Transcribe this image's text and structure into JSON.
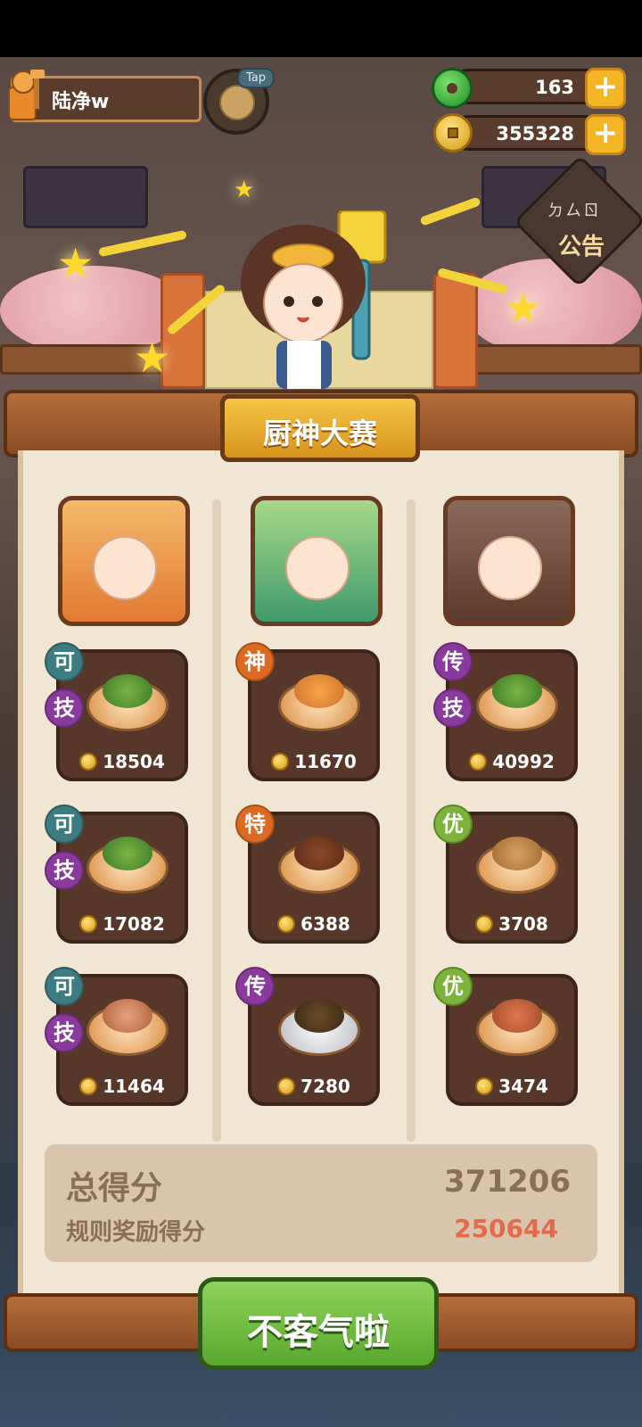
{
  "player": {
    "name": "陆净w"
  },
  "tap_button": {
    "label": "Tap"
  },
  "resources": {
    "jade": "163",
    "coins": "355328"
  },
  "notice": {
    "label": "公告",
    "sub": "ㄉㄙㄖ"
  },
  "contest": {
    "title": "厨神大赛"
  },
  "dishes": [
    {
      "score": "18504",
      "badges": [
        "可",
        "技"
      ]
    },
    {
      "score": "11670",
      "badges": [
        "神"
      ]
    },
    {
      "score": "40992",
      "badges": [
        "传",
        "技"
      ]
    },
    {
      "score": "17082",
      "badges": [
        "可",
        "技"
      ]
    },
    {
      "score": "6388",
      "badges": [
        "特"
      ]
    },
    {
      "score": "3708",
      "badges": [
        "优"
      ]
    },
    {
      "score": "11464",
      "badges": [
        "可",
        "技"
      ]
    },
    {
      "score": "7280",
      "badges": [
        "传"
      ]
    },
    {
      "score": "3474",
      "badges": [
        "优"
      ]
    }
  ],
  "summary": {
    "total_label": "总得分",
    "total_value": "371206",
    "bonus_label": "规则奖励得分",
    "bonus_value": "250644"
  },
  "confirm": {
    "label": "不客气啦"
  },
  "colors": {
    "confirm": "#6cbc3e",
    "bonus": "#e46a4e",
    "title_plate": "#e8a92a"
  }
}
